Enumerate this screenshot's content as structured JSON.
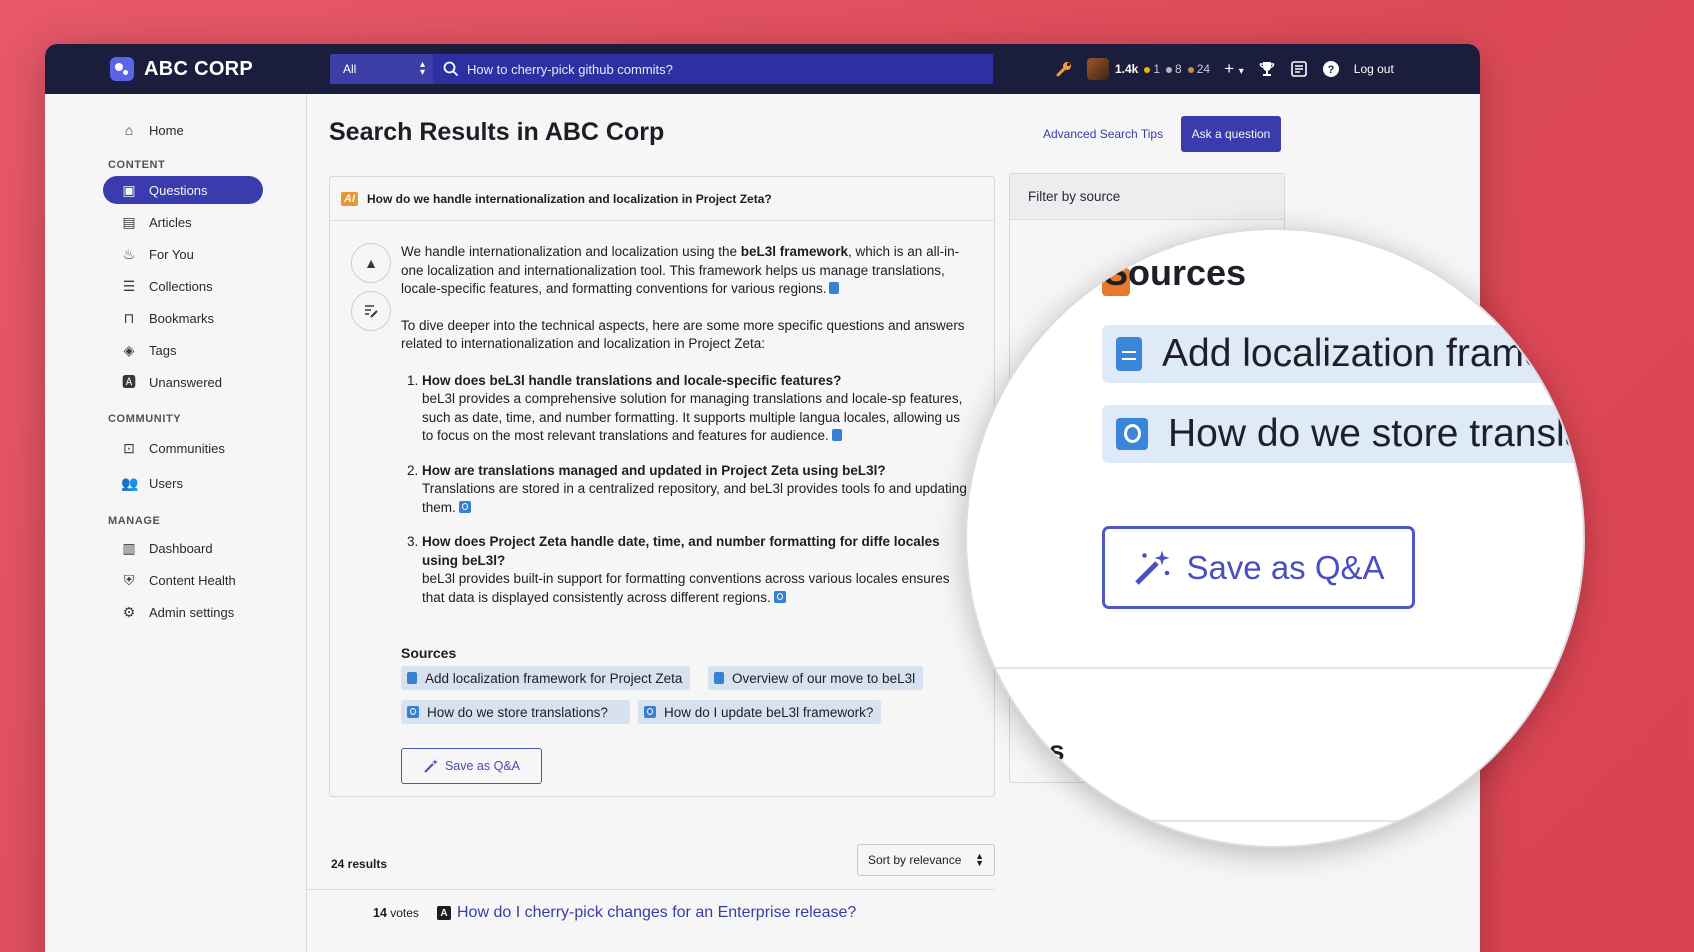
{
  "topbar": {
    "brand": "ABC CORP",
    "scope": "All",
    "search_placeholder": "How to cherry-pick github commits?",
    "reputation": "1.4k",
    "gold": "1",
    "silver": "8",
    "bronze": "24",
    "logout": "Log out"
  },
  "sidebar": {
    "home": "Home",
    "content_label": "CONTENT",
    "questions": "Questions",
    "articles": "Articles",
    "for_you": "For You",
    "collections": "Collections",
    "bookmarks": "Bookmarks",
    "tags": "Tags",
    "unanswered": "Unanswered",
    "community_label": "COMMUNITY",
    "communities": "Communities",
    "users": "Users",
    "manage_label": "MANAGE",
    "dashboard": "Dashboard",
    "content_health": "Content Health",
    "admin_settings": "Admin settings"
  },
  "main": {
    "title": "Search Results in ABC Corp",
    "advanced_tips": "Advanced Search Tips",
    "ask_button": "Ask a question",
    "ai_badge": "AI",
    "ai_question": "How do we handle internationalization and localization in Project Zeta?",
    "answer_intro_pre": "We handle internationalization and localization using the ",
    "answer_intro_bold": "beL3l framework",
    "answer_intro_post": ", which is an all-in-one localization and internationalization tool. This framework helps us manage translations, locale-specific features, and formatting conventions for various regions.",
    "answer_dive": "To dive deeper into the technical aspects, here are some more specific questions and answers related to internationalization and localization in Project Zeta:",
    "qa": [
      {
        "q": "How does beL3l handle translations and locale-specific features?",
        "a": "beL3l provides a comprehensive solution for managing translations and locale-sp features, such as date, time, and number formatting. It supports multiple langua locales, allowing us to focus on the most relevant translations and features for audience."
      },
      {
        "q": "How are translations managed and updated in Project Zeta using beL3l?",
        "a": "Translations are stored in a centralized repository, and beL3l provides tools fo and updating them."
      },
      {
        "q": "How does Project Zeta handle date, time, and number formatting for diffe locales using beL3l?",
        "a": "beL3l provides built-in support for formatting conventions across various locales ensures that data is displayed consistently across different regions."
      }
    ],
    "sources_title": "Sources",
    "sources": [
      "Add localization framework for Project Zeta",
      "Overview of our move to beL3l",
      "How do we store translations?",
      "How do I update beL3l framework?"
    ],
    "save_button": "Save as Q&A",
    "results_count": "24 results",
    "sort": "Sort by relevance",
    "result": {
      "votes_num": "14",
      "votes_label": "votes",
      "title": "How do I cherry-pick changes for an Enterprise release?"
    },
    "filter_title": "Filter by source"
  },
  "magnifier": {
    "title": "Sources",
    "chip1": "Add localization frame",
    "chip2": "How do we store translati",
    "save": "Save as Q&A",
    "fragment": "s"
  },
  "colors": {
    "accent": "#3d3fb5",
    "topbar": "#1a1d3b",
    "link": "#3a3fb0",
    "source_chip": "#dfeaf8",
    "background": "#e05262"
  }
}
